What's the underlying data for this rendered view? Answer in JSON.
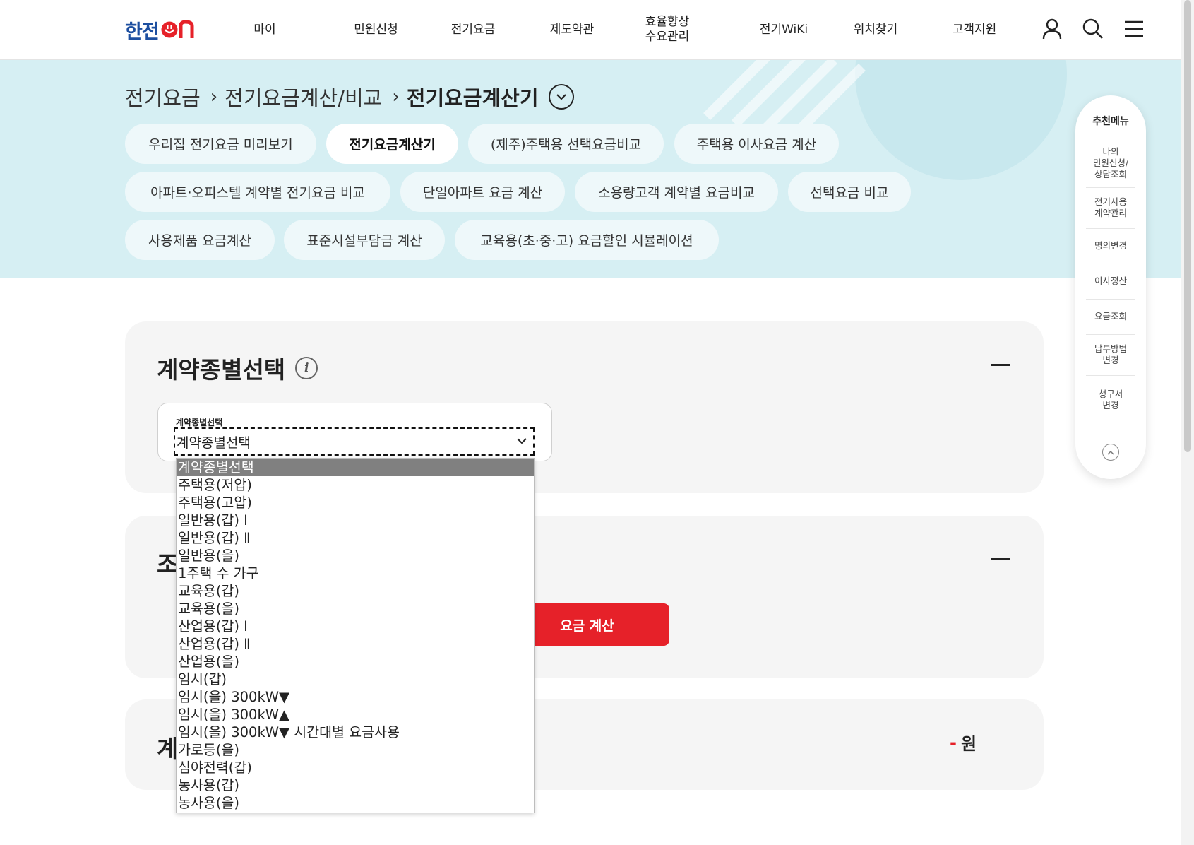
{
  "header": {
    "logo_text": "한전",
    "logo_on": "ON",
    "nav": [
      {
        "label": "마이"
      },
      {
        "label": "민원신청"
      },
      {
        "label": "전기요금"
      },
      {
        "label": "제도약관"
      },
      {
        "label": "효율향상\n수요관리"
      },
      {
        "label": "전기WiKi"
      },
      {
        "label": "위치찾기"
      },
      {
        "label": "고객지원"
      }
    ],
    "icons": [
      "user-icon",
      "search-icon",
      "menu-icon"
    ]
  },
  "breadcrumb": {
    "items": [
      "전기요금",
      "전기요금계산/비교"
    ],
    "current": "전기요금계산기"
  },
  "chips": [
    {
      "label": "우리집 전기요금 미리보기",
      "active": false
    },
    {
      "label": "전기요금계산기",
      "active": true
    },
    {
      "label": "(제주)주택용 선택요금비교",
      "active": false
    },
    {
      "label": "주택용 이사요금 계산",
      "active": false
    },
    {
      "label": "아파트·오피스텔 계약별 전기요금 비교",
      "active": false
    },
    {
      "label": "단일아파트 요금 계산",
      "active": false
    },
    {
      "label": "소용량고객 계약별 요금비교",
      "active": false
    },
    {
      "label": "선택요금 비교",
      "active": false
    },
    {
      "label": "사용제품 요금계산",
      "active": false
    },
    {
      "label": "표준시설부담금 계산",
      "active": false
    },
    {
      "label": "교육용(초·중·고) 요금할인 시뮬레이션",
      "active": false
    }
  ],
  "contract_card": {
    "title": "계약종별선택",
    "select_label": "계약종별선택",
    "select_value": "계약종별선택"
  },
  "dropdown": {
    "options": [
      "계약종별선택",
      "주택용(저압)",
      "주택용(고압)",
      "일반용(갑) Ⅰ",
      "일반용(갑) Ⅱ",
      "일반용(을)",
      "1주택 수 가구",
      "교육용(갑)",
      "교육용(을)",
      "산업용(갑) Ⅰ",
      "산업용(갑) Ⅱ",
      "산업용(을)",
      "임시(갑)",
      "임시(을) 300kW▼",
      "임시(을) 300kW▲",
      "임시(을) 300kW▼ 시간대별 요금사용",
      "가로등(을)",
      "심야전력(갑)",
      "농사용(갑)",
      "농사용(을)"
    ],
    "selected_index": 0
  },
  "card2": {
    "title_peek": "조",
    "button": "요금 계산"
  },
  "card3": {
    "title_peek": "계",
    "amount_dash": "-",
    "amount_unit": "원"
  },
  "side_menu": {
    "title": "추천메뉴",
    "items": [
      "나의\n민원신청/\n상담조회",
      "전기사용\n계약관리",
      "명의변경",
      "이사정산",
      "요금조회",
      "납부방법\n변경",
      "청구서\n변경"
    ]
  },
  "colors": {
    "brand_blue": "#1d4fa0",
    "brand_red": "#e62129",
    "hero_bg": "#d6eff3"
  }
}
